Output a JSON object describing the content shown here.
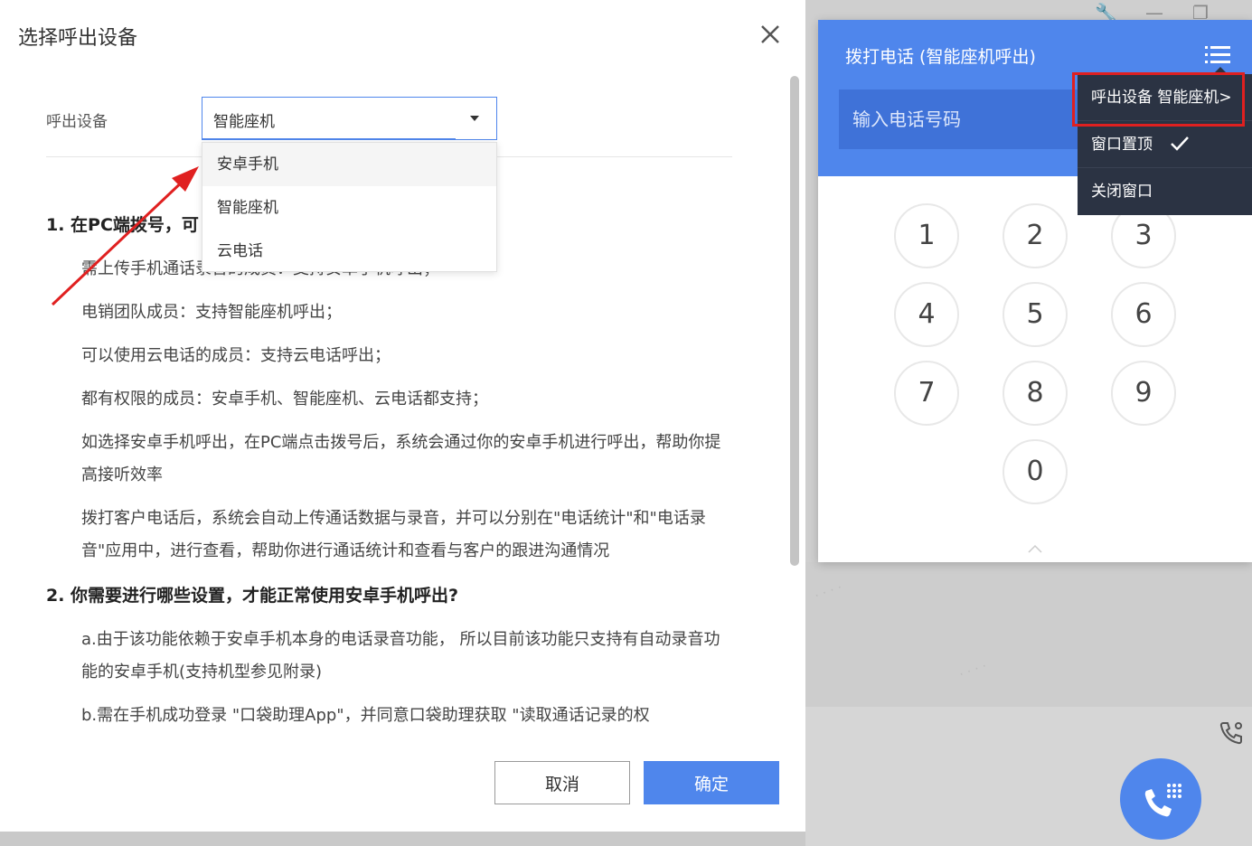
{
  "modal": {
    "title": "选择呼出设备",
    "field_label": "呼出设备",
    "select_value": "智能座机",
    "options": [
      "安卓手机",
      "智能座机",
      "云电话"
    ],
    "content": {
      "h1": "1. 在PC端拨号，可",
      "p1": "需上传手机通话录音的成员：支持安卓手机呼出；",
      "p2": "电销团队成员：支持智能座机呼出；",
      "p3": "可以使用云电话的成员：支持云电话呼出；",
      "p4": "都有权限的成员：安卓手机、智能座机、云电话都支持；",
      "p5": "如选择安卓手机呼出，在PC端点击拨号后，系统会通过你的安卓手机进行呼出，帮助你提高接听效率",
      "p6": "拨打客户电话后，系统会自动上传通话数据与录音，并可以分别在\"电话统计\"和\"电话录音\"应用中，进行查看，帮助你进行通话统计和查看与客户的跟进沟通情况",
      "h2": "2. 你需要进行哪些设置，才能正常使用安卓手机呼出?",
      "p7": "a.由于该功能依赖于安卓手机本身的电话录音功能， 所以目前该功能只支持有自动录音功能的安卓手机(支持机型参见附录)",
      "p8": "b.需在手机成功登录 \"口袋助理App\"，并同意口袋助理获取 \"读取通话记录的权"
    },
    "cancel_label": "取消",
    "ok_label": "确定"
  },
  "dialer": {
    "title": "拨打电话 (智能座机呼出)",
    "input_placeholder": "输入电话号码",
    "keys": [
      "1",
      "2",
      "3",
      "4",
      "5",
      "6",
      "7",
      "8",
      "9",
      "0"
    ]
  },
  "menu": {
    "item1": "呼出设备 智能座机>",
    "item2": "窗口置顶",
    "item3": "关闭窗口"
  },
  "colors": {
    "accent": "#4f86ec",
    "menu_bg": "#2b3343",
    "highlight": "#e02020"
  }
}
